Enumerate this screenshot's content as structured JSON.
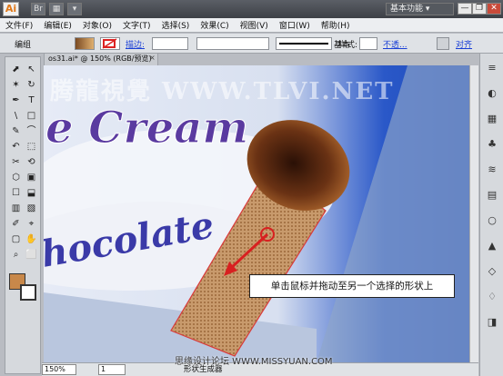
{
  "app": {
    "logo": "Ai"
  },
  "titlebar": {
    "icons": [
      "bridge-icon",
      "arrange-icon",
      "view-icon"
    ],
    "icon_glyphs": [
      "Br",
      "▦",
      "▾"
    ],
    "workspace": "基本功能 ▾",
    "win_buttons": [
      "—",
      "❐",
      "✕"
    ]
  },
  "menu": [
    "文件(F)",
    "编辑(E)",
    "对象(O)",
    "文字(T)",
    "选择(S)",
    "效果(C)",
    "视图(V)",
    "窗口(W)",
    "帮助(H)"
  ],
  "control": {
    "selection": "编组",
    "stroke_label": "描边:",
    "stroke_value": "",
    "brush": "基本",
    "style_label": "样式:",
    "opacity_link": "不透...",
    "align_link": "对齐"
  },
  "document": {
    "tab_title": "os31.ai* @ 150% (RGB/预览)",
    "close": "×"
  },
  "canvas": {
    "artwork_title_1": "e Cream",
    "artwork_title_2": "hocolate",
    "watermark": "腾龍視覺 WWW.TLVI.NET",
    "callout": "单击鼠标并拖动至另一个选择的形状上"
  },
  "statusbar": {
    "zoom": "150%",
    "page": "1",
    "status": "形状生成器",
    "watermark_bottom": "思缘设计论坛 WWW.MISSYUAN.COM"
  },
  "tools": [
    "⬈",
    "↖",
    "✶",
    "↻",
    "✒",
    "T",
    "\\",
    "□",
    "✎",
    "⌒",
    "↶",
    "⬚",
    "✂",
    "⟲",
    "⬡",
    "▣",
    "☐",
    "⬓",
    "▥",
    "▧",
    "✐",
    "⌖",
    "▢",
    "✋",
    "⌕",
    "⬜"
  ],
  "right_panel": [
    "≡",
    "◐",
    "▦",
    "♣",
    "≋",
    "▤",
    "○",
    "▲",
    "◇",
    "♢",
    "◨"
  ],
  "colors": {
    "fill": "#c8884a",
    "stroke": "#ffffff",
    "accent_blue": "#1a3fd6"
  }
}
